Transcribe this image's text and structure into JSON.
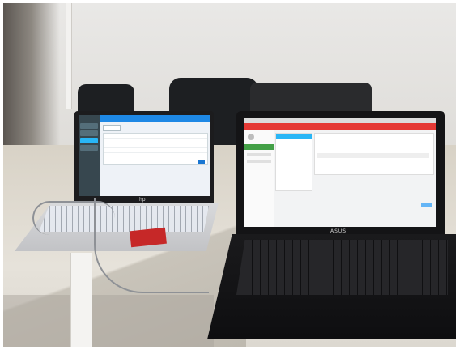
{
  "scene": {
    "description_kind": "photo",
    "hp_laptop": {
      "brand_logo": "hp",
      "sticker_text": "",
      "screen": {
        "app_title": "",
        "tab_label": ""
      }
    },
    "asus_laptop": {
      "brand_logo": "ASUS",
      "screen": {
        "header_title": ""
      }
    }
  },
  "colors": {
    "hp_topbar": "#1e88e5",
    "asus_topbar": "#e53935",
    "asus_green": "#43a047",
    "sticker": "#c62828"
  }
}
